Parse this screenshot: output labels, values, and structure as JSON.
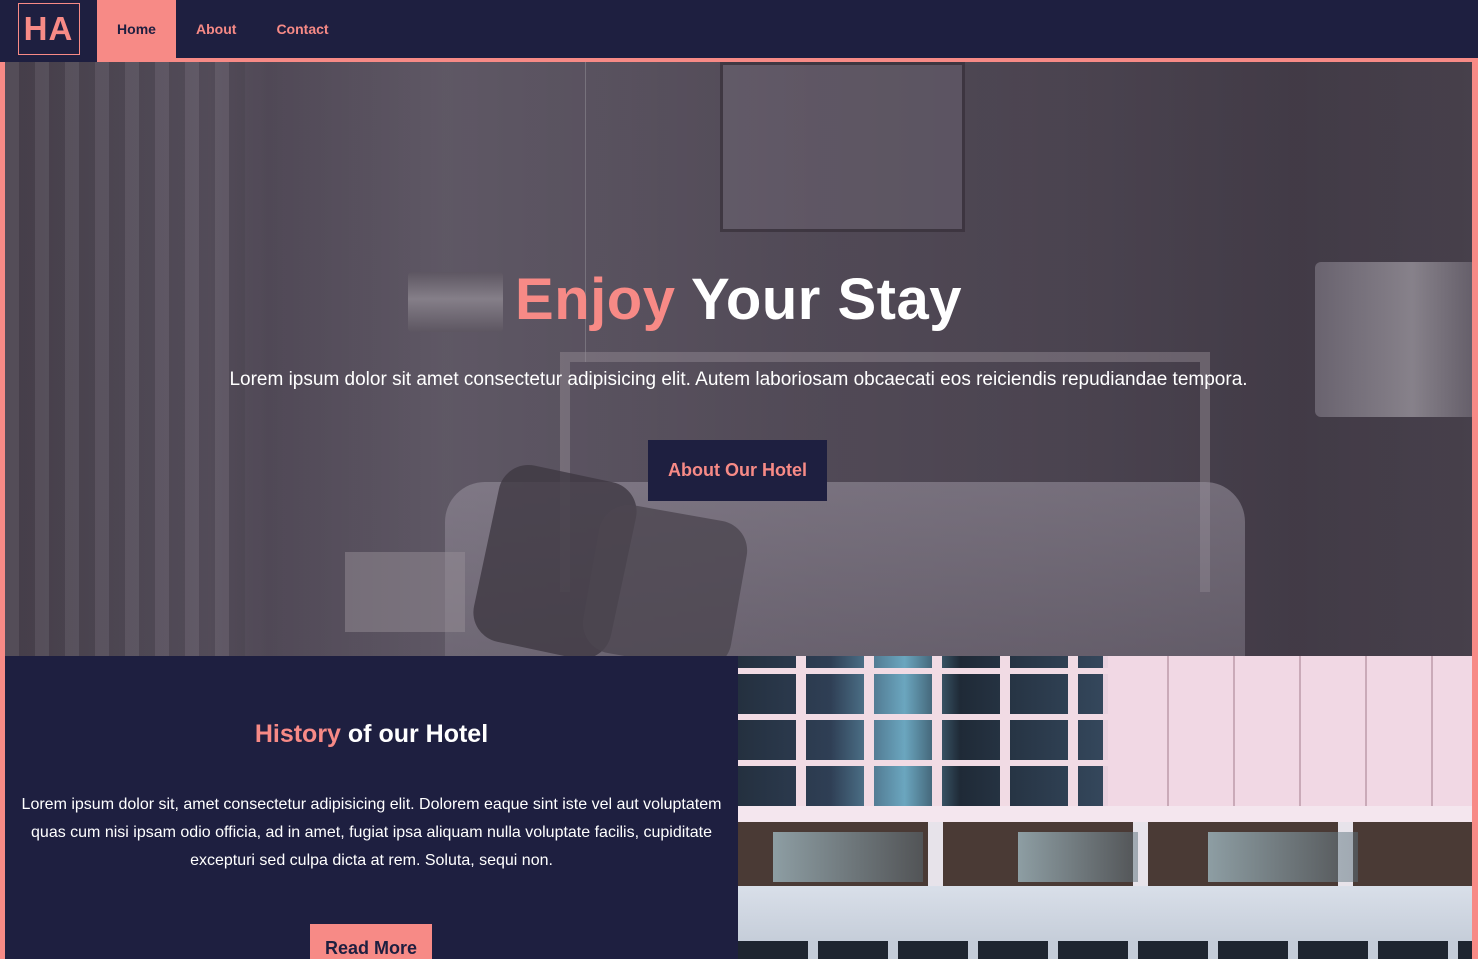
{
  "nav": {
    "logo": "HA",
    "links": [
      {
        "label": "Home",
        "active": true
      },
      {
        "label": "About",
        "active": false
      },
      {
        "label": "Contact",
        "active": false
      }
    ]
  },
  "hero": {
    "title_accent": "Enjoy",
    "title_rest": " Your Stay",
    "subtitle": "Lorem ipsum dolor sit amet consectetur adipisicing elit. Autem laboriosam obcaecati eos reiciendis repudiandae tempora.",
    "button_label": "About Our Hotel"
  },
  "history": {
    "title_accent": "History",
    "title_rest": " of our Hotel",
    "text": "Lorem ipsum dolor sit, amet consectetur adipisicing elit. Dolorem eaque sint iste vel aut voluptatem quas cum nisi ipsam odio officia, ad in amet, fugiat ipsa aliquam nulla voluptate facilis, cupiditate excepturi sed culpa dicta at rem. Soluta, sequi non.",
    "button_label": "Read More"
  },
  "colors": {
    "navy": "#1e1f40",
    "accent": "#f78a86",
    "text": "#ffffff"
  }
}
